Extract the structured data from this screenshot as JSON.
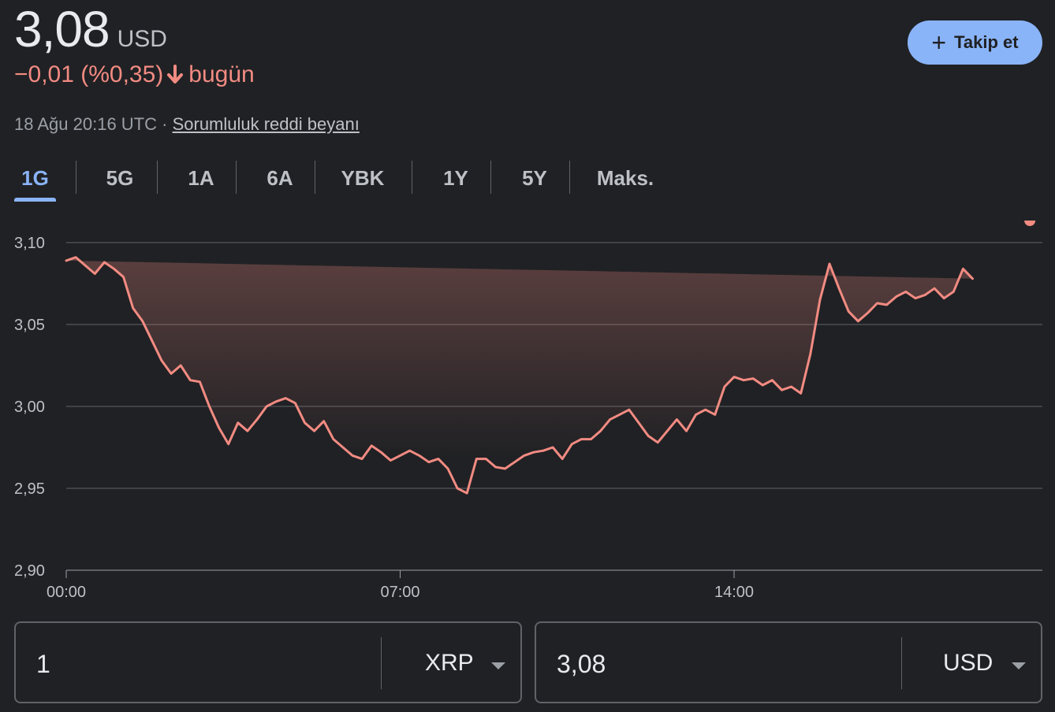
{
  "quote": {
    "price": "3,08",
    "currency": "USD",
    "change": "−0,01 (%0,35)",
    "change_suffix": "bugün",
    "timestamp": "18 Ağu 20:16 UTC ·",
    "disclaimer": "Sorumluluk reddi beyanı",
    "down_color": "#f28b82"
  },
  "follow_button": {
    "label": "Takip et"
  },
  "tabs": [
    {
      "label": "1G",
      "active": true
    },
    {
      "label": "5G"
    },
    {
      "label": "1A"
    },
    {
      "label": "6A"
    },
    {
      "label": "YBK"
    },
    {
      "label": "1Y"
    },
    {
      "label": "5Y"
    },
    {
      "label": "Maks."
    }
  ],
  "chart_data": {
    "type": "line",
    "ylim": [
      2.9,
      3.1
    ],
    "y_ticks": [
      "3,10",
      "3,05",
      "3,00",
      "2,95",
      "2,90"
    ],
    "y_tick_values": [
      3.1,
      3.05,
      3.0,
      2.95,
      2.9
    ],
    "x_tick_labels": [
      "00:00",
      "07:00",
      "14:00"
    ],
    "x_tick_hours": [
      0,
      7,
      14
    ],
    "grid": true,
    "line_color": "#f28b82",
    "series": [
      {
        "x_hours": [
          0,
          0.2,
          0.4,
          0.6,
          0.8,
          1,
          1.2,
          1.4,
          1.6,
          1.8,
          2,
          2.2,
          2.4,
          2.6,
          2.8,
          3,
          3.2,
          3.4,
          3.6,
          3.8,
          4,
          4.2,
          4.4,
          4.6,
          4.8,
          5,
          5.2,
          5.4,
          5.6,
          5.8,
          6,
          6.2,
          6.4,
          6.6,
          6.8,
          7,
          7.2,
          7.4,
          7.6,
          7.8,
          8,
          8.2,
          8.4,
          8.6,
          8.8,
          9,
          9.2,
          9.4,
          9.6,
          9.8,
          10,
          10.2,
          10.4,
          10.6,
          10.8,
          11,
          11.2,
          11.4,
          11.6,
          11.8,
          12,
          12.2,
          12.4,
          12.6,
          12.8,
          13,
          13.2,
          13.4,
          13.6,
          13.8,
          14,
          14.2,
          14.4,
          14.6,
          14.8,
          15,
          15.2,
          15.4,
          15.6,
          15.8,
          16,
          16.2,
          16.4,
          16.6,
          16.8,
          17,
          17.2,
          17.4,
          17.6,
          17.8,
          18,
          18.2,
          18.4,
          18.6,
          18.8,
          19,
          19.2,
          19.4,
          19.6,
          19.8,
          20,
          20.2
        ],
        "values": [
          3.089,
          3.091,
          3.086,
          3.081,
          3.088,
          3.084,
          3.079,
          3.06,
          3.052,
          3.04,
          3.028,
          3.02,
          3.025,
          3.016,
          3.015,
          3.0,
          2.987,
          2.977,
          2.99,
          2.985,
          2.992,
          3.0,
          3.003,
          3.005,
          3.002,
          2.99,
          2.985,
          2.991,
          2.98,
          2.975,
          2.97,
          2.968,
          2.976,
          2.972,
          2.967,
          2.97,
          2.973,
          2.97,
          2.966,
          2.968,
          2.962,
          2.95,
          2.947,
          2.968,
          2.968,
          2.963,
          2.962,
          2.966,
          2.97,
          2.972,
          2.973,
          2.975,
          2.968,
          2.977,
          2.98,
          2.98,
          2.985,
          2.992,
          2.995,
          2.998,
          2.99,
          2.982,
          2.978,
          2.985,
          2.992,
          2.985,
          2.995,
          2.998,
          2.995,
          3.012,
          3.018,
          3.016,
          3.017,
          3.013,
          3.016,
          3.01,
          3.012,
          3.008,
          3.032,
          3.065,
          3.087,
          3.072,
          3.058,
          3.052,
          3.057,
          3.063,
          3.062,
          3.067,
          3.07,
          3.066,
          3.068,
          3.072,
          3.066,
          3.07,
          3.084,
          3.078
        ]
      }
    ]
  },
  "converter": {
    "from": {
      "value": "1",
      "unit": "XRP"
    },
    "to": {
      "value": "3,08",
      "unit": "USD"
    }
  }
}
